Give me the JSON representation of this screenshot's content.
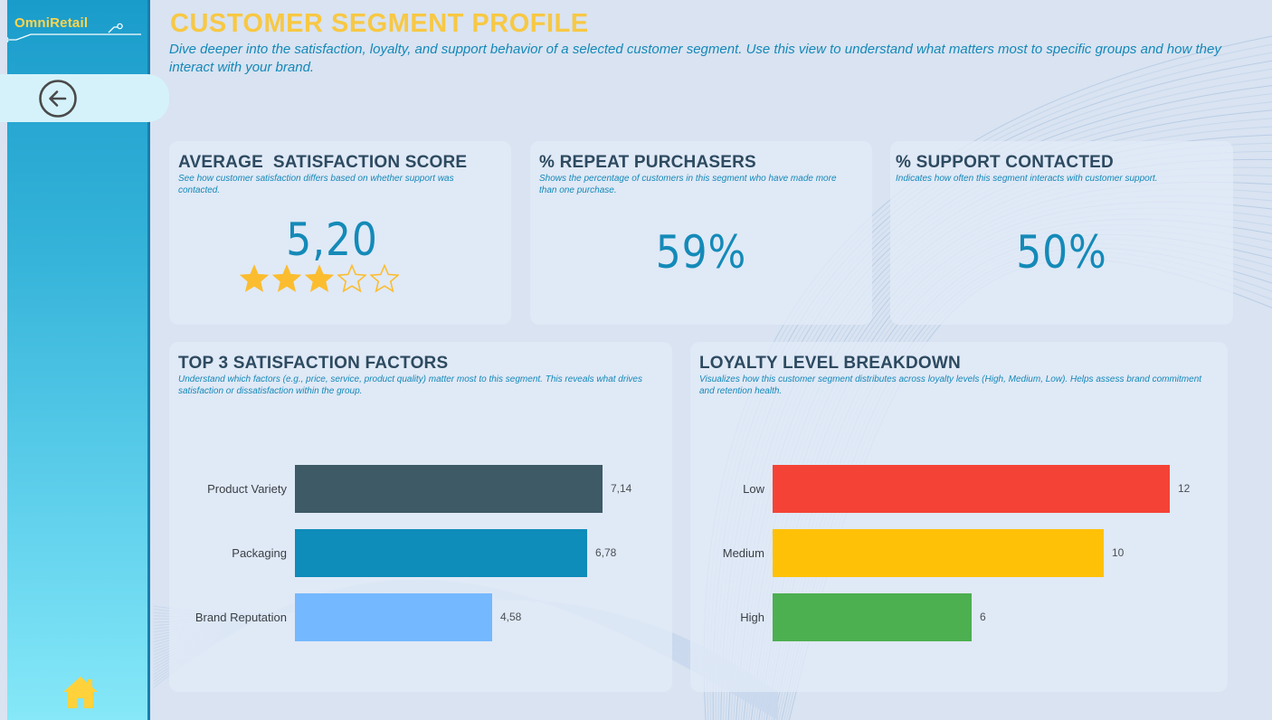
{
  "app": {
    "logo": "OmniRetail"
  },
  "header": {
    "title": "CUSTOMER SEGMENT PROFILE",
    "subtitle": "Dive deeper into the satisfaction, loyalty, and support behavior of a selected customer segment. Use this view to understand what matters most to specific groups and how they interact with your brand."
  },
  "nav": {
    "back": "back-arrow-icon",
    "home": "home-icon"
  },
  "kpis": {
    "satisfaction": {
      "title": "AVERAGE  SATISFACTION SCORE",
      "desc": "See how customer satisfaction differs based on whether support was contacted.",
      "value": "5,20",
      "stars_filled": 3,
      "stars_total": 5
    },
    "repeat": {
      "title": "% REPEAT PURCHASERS",
      "desc": "Shows the percentage of customers in this segment who have made more than one purchase.",
      "value": "59%"
    },
    "support": {
      "title": "% SUPPORT CONTACTED",
      "desc": "Indicates how often this segment interacts with customer support.",
      "value": "50%"
    }
  },
  "factors": {
    "title": "TOP 3 SATISFACTION FACTORS",
    "desc": "Understand which factors (e.g., price, service, product quality) matter most to this segment. This reveals what drives satisfaction or dissatisfaction within the group."
  },
  "loyalty": {
    "title": "LOYALTY LEVEL BREAKDOWN",
    "desc": "Visualizes how this customer segment distributes across loyalty levels (High, Medium, Low). Helps assess brand commitment and retention health."
  },
  "colors": {
    "accent": "#f7c844",
    "primary": "#148ab8",
    "factor_bars": [
      "#3d5a66",
      "#0e8cba",
      "#74b8ff"
    ],
    "loyalty_bars": [
      "#f44336",
      "#ffc107",
      "#4caf50"
    ]
  },
  "chart_data": [
    {
      "type": "bar",
      "orientation": "horizontal",
      "title": "TOP 3 SATISFACTION FACTORS",
      "categories": [
        "Product Variety",
        "Packaging",
        "Brand Reputation"
      ],
      "values": [
        7.14,
        6.78,
        4.58
      ],
      "value_labels": [
        "7,14",
        "6,78",
        "4,58"
      ],
      "xlim": [
        0,
        7.14
      ]
    },
    {
      "type": "bar",
      "orientation": "horizontal",
      "title": "LOYALTY LEVEL BREAKDOWN",
      "categories": [
        "Low",
        "Medium",
        "High"
      ],
      "values": [
        12,
        10,
        6
      ],
      "value_labels": [
        "12",
        "10",
        "6"
      ],
      "xlim": [
        0,
        12
      ]
    }
  ]
}
